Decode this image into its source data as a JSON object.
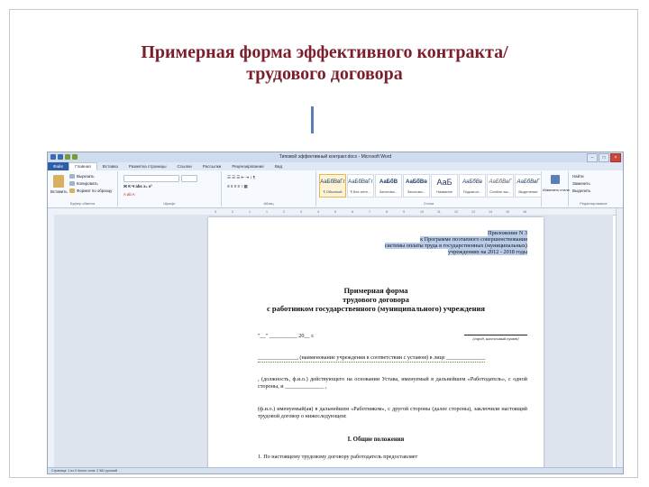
{
  "slide": {
    "title_line1": "Примерная форма эффективного контракта/",
    "title_line2": "трудового договора"
  },
  "word": {
    "window_title": "Типовой эффективный контракт.docx - Microsoft Word",
    "menu_tabs": [
      "Файл",
      "Главная",
      "Вставка",
      "Разметка страницы",
      "Ссылки",
      "Рассылки",
      "Рецензирование",
      "Вид"
    ],
    "ribbon": {
      "paste": "Вставить",
      "cut": "Вырезать",
      "copy": "Копировать",
      "format_painter": "Формат по образцу",
      "clipboard": "Буфер обмена",
      "font": "Шрифт",
      "paragraph": "Абзац",
      "styles_group": "Стили",
      "edit_group": "Редактирование",
      "change_styles": "Изменить стили",
      "find": "Найти",
      "replace": "Заменить",
      "select": "Выделить",
      "styles": [
        {
          "preview": "АаБбВвГг",
          "name": "¶ Обычный"
        },
        {
          "preview": "АаБбВвГг",
          "name": "¶ Без инте..."
        },
        {
          "preview": "АаБбВ",
          "name": "Заголово..."
        },
        {
          "preview": "АаБбВв",
          "name": "Заголово..."
        },
        {
          "preview": "АаБ",
          "name": "Название"
        },
        {
          "preview": "АаБбВв",
          "name": "Подзагол..."
        },
        {
          "preview": "АаБбВвГ",
          "name": "Слабое вы..."
        },
        {
          "preview": "АаБбВвГ",
          "name": "Выделение"
        }
      ]
    },
    "status": "Страница: 1 из 9   Число слов: 2 981   русский",
    "ruler_marks": [
      "3",
      "2",
      "1",
      "1",
      "2",
      "3",
      "4",
      "5",
      "6",
      "7",
      "8",
      "9",
      "10",
      "11",
      "12",
      "13",
      "14",
      "15",
      "16"
    ]
  },
  "document": {
    "appendix": [
      "Приложение N 3",
      "к Программе поэтапного совершенствования",
      "системы оплаты труда в государственных (муниципальных)",
      "учреждениях на 2012 - 2018 годы"
    ],
    "title": [
      "Примерная форма",
      "трудового договора",
      "с работником государственного (муниципального) учреждения"
    ],
    "date_line": "\"__\" __________ 20__ г.",
    "place_caption": "(город, населенный пункт)",
    "para1": "______________, (наименование учреждения в соответствии с уставом) в лице ______________",
    "para2": ", (должность, ф.и.о.) действующего на основании Устава, именуемый в дальнейшем «Работодатель», с одной стороны, и ______________ ,",
    "para3": "(ф.и.о.) именуемый(ая) в дальнейшем «Работником», с другой стороны (далее стороны), заключили настоящий трудовой договор о нижеследующем:",
    "section": "I.      Общие положения",
    "p1": "1. По настоящему трудовому договору работодатель предоставляет"
  }
}
